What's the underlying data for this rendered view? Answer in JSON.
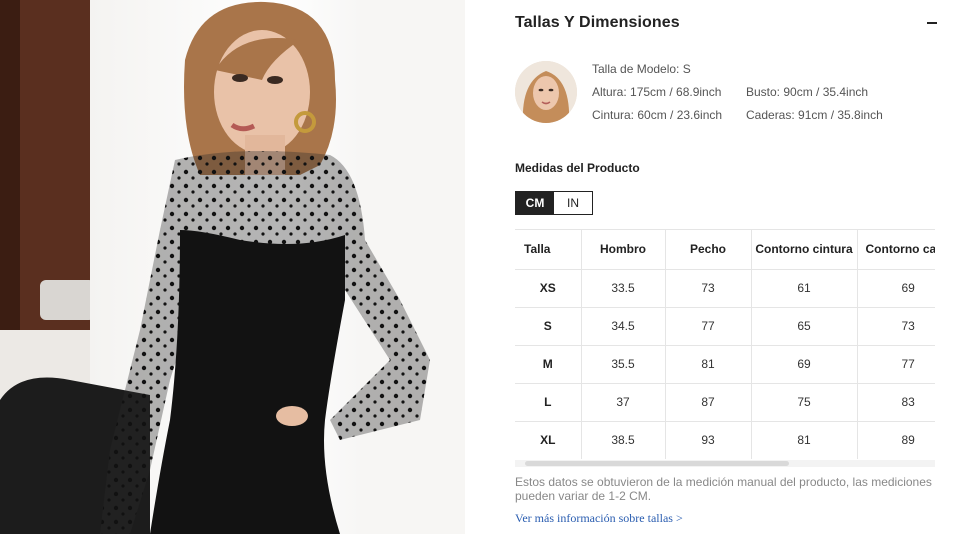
{
  "size_guide": {
    "title": "Tallas Y Dimensiones",
    "collapse_icon": "minus-icon"
  },
  "model": {
    "size": "Talla de Modelo: S",
    "height": "Altura: 175cm / 68.9inch",
    "bust": "Busto: 90cm / 35.4inch",
    "waist": "Cintura: 60cm / 23.6inch",
    "hips": "Caderas: 91cm / 35.8inch"
  },
  "measurements": {
    "title": "Medidas del Producto",
    "units": {
      "cm": "CM",
      "in": "IN",
      "selected": "CM"
    },
    "headers": [
      "Talla",
      "Hombro",
      "Pecho",
      "Contorno cintura",
      "Contorno caderas"
    ],
    "rows": [
      [
        "XS",
        "33.5",
        "73",
        "61",
        "69"
      ],
      [
        "S",
        "34.5",
        "77",
        "65",
        "73"
      ],
      [
        "M",
        "35.5",
        "81",
        "69",
        "77"
      ],
      [
        "L",
        "37",
        "87",
        "75",
        "83"
      ],
      [
        "XL",
        "38.5",
        "93",
        "81",
        "89"
      ]
    ],
    "note": "Estos datos se obtuvieron de la medición manual del producto, las mediciones pueden variar de 1-2 CM.",
    "more_link": "Ver más información sobre tallas >"
  },
  "colors": {
    "dark": "#222222",
    "link": "#2a5db0",
    "border": "#e5e5e5"
  }
}
